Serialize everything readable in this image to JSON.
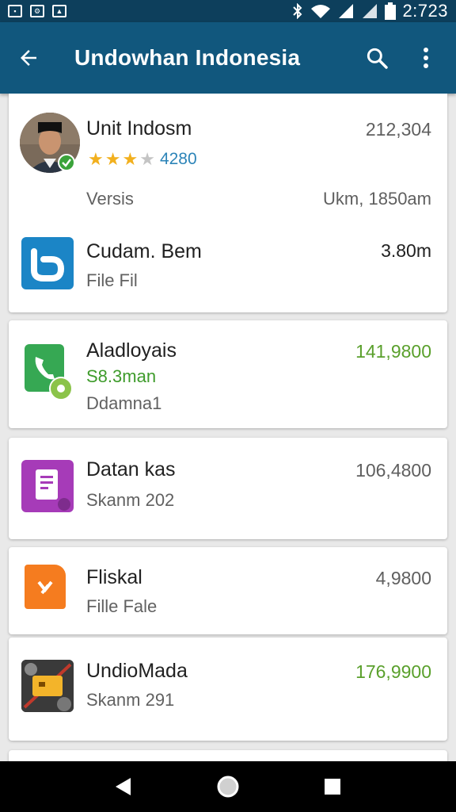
{
  "status_bar": {
    "time": "2:723"
  },
  "app_bar": {
    "title": "Undowhan Indonesia"
  },
  "cards": [
    {
      "rows": [
        {
          "name": "Unit Indosm",
          "value": "212,304",
          "rating_label": "4280",
          "stars_filled": 3,
          "stars_total": 4,
          "sub_left": "Versis",
          "sub_right": "Ukm, 1850am"
        },
        {
          "name": "Cudam. Bem",
          "value": "3.80m",
          "sub": "File Fil"
        }
      ]
    },
    {
      "rows": [
        {
          "name": "Aladloyais",
          "value": "141,9800",
          "sub_green": "S8.3man",
          "sub": "Ddamna1"
        }
      ]
    },
    {
      "rows": [
        {
          "name": "Datan kas",
          "value": "106,4800",
          "sub": "Skanm 202"
        }
      ]
    },
    {
      "rows": [
        {
          "name": "Fliskal",
          "value": "4,9800",
          "sub": "Fille Fale"
        }
      ]
    },
    {
      "rows": [
        {
          "name": "UndioMada",
          "value": "176,9900",
          "sub": "Skanm 291"
        }
      ]
    }
  ],
  "colors": {
    "app_bar": "#11577d",
    "status_bar": "#0d3f5c",
    "accent_green": "#5aa02c",
    "rating_blue": "#2c84b8"
  },
  "icons": [
    "back-arrow-icon",
    "search-icon",
    "more-vert-icon",
    "back-nav-icon",
    "home-nav-icon",
    "recents-nav-icon"
  ]
}
